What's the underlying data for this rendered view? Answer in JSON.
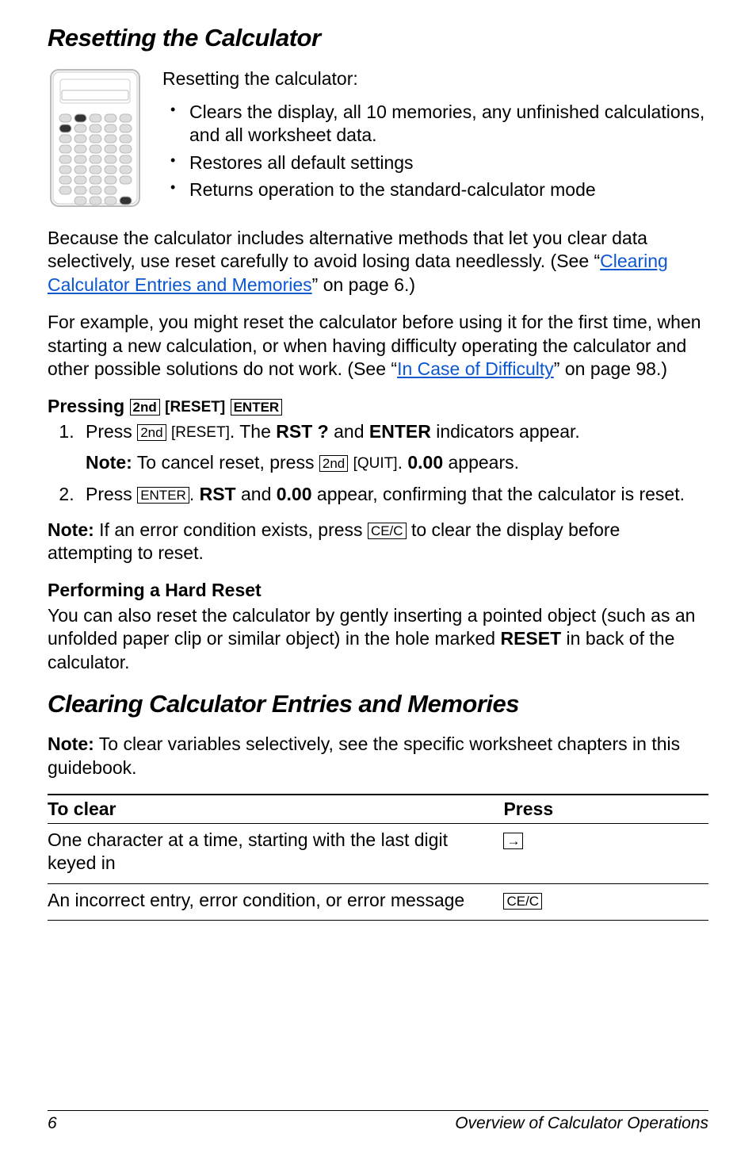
{
  "h1_a": "Resetting the Calculator",
  "intro": {
    "line": "Resetting the calculator:"
  },
  "bullets": [
    "Clears the display, all 10 memories, any unfinished calculations, and all worksheet data.",
    "Restores all default settings",
    "Returns operation to the standard-calculator mode"
  ],
  "para1_a": "Because the calculator includes alternative methods that let you clear data selectively, use reset carefully to avoid losing data needlessly. (See “",
  "para1_link": "Clearing Calculator Entries and Memories",
  "para1_b": "” on page 6.)",
  "para2_a": "For example, you might reset the calculator before using it for the first time, when starting a new calculation, or when having difficulty operating the calculator and other possible solutions do not work. (See “",
  "para2_link": "In Case of Difficulty",
  "para2_b": "” on page 98.)",
  "sub1": "Pressing ",
  "keys": {
    "second": "2nd",
    "reset": "RESET",
    "enter": "ENTER",
    "quit": "QUIT",
    "cec": "CE/C",
    "arrow": "→"
  },
  "step1_a": "Press ",
  "step1_b": ". The ",
  "step1_c": " and ",
  "step1_d": " indicators appear.",
  "ind_rst": "RST ?",
  "ind_enter": "ENTER",
  "step1_note_a": "Note:",
  "step1_note_b": " To cancel reset, press ",
  "step1_note_c": ". ",
  "zero": "0.00",
  "step1_note_d": " appears.",
  "step2_a": "Press ",
  "step2_b": ". ",
  "rst": "RST",
  "step2_c": " and ",
  "step2_d": " appear, confirming that the calculator is reset.",
  "note_err_a": "Note:",
  "note_err_b": " If an error condition exists, press ",
  "note_err_c": " to clear the display before attempting to reset.",
  "sub2": "Performing a Hard Reset",
  "hard_a": "You can also reset the calculator by gently inserting a pointed object (such as an unfolded paper clip or similar object) in the hole marked ",
  "hard_b": "RESET",
  "hard_c": " in back of the calculator.",
  "h1_b": "Clearing Calculator Entries and Memories",
  "clear_note_a": "Note:",
  "clear_note_b": " To clear variables selectively, see the specific worksheet chapters in this guidebook.",
  "tbl": {
    "h1": "To clear",
    "h2": "Press",
    "r1": "One character at a time, starting with the last digit keyed in",
    "r2": "An incorrect entry, error condition, or error message"
  },
  "footer": {
    "page": "6",
    "title": "Overview of Calculator Operations"
  }
}
